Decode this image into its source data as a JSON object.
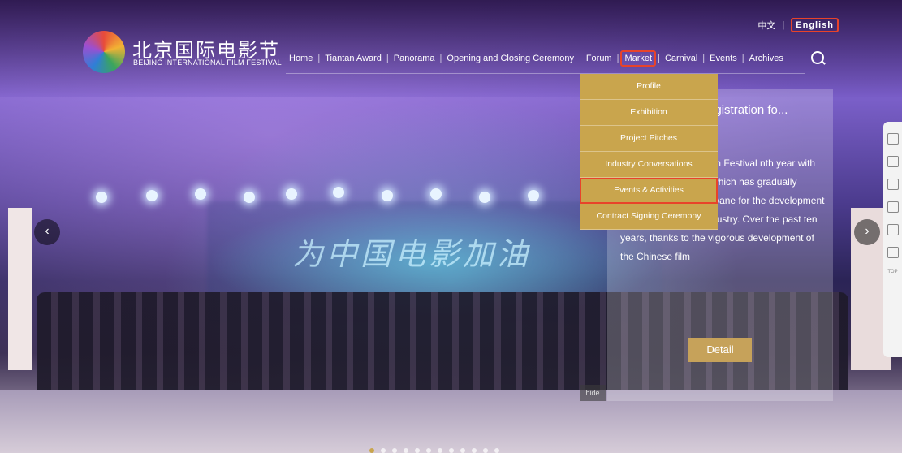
{
  "header": {
    "logo_cn": "北京国际电影节",
    "logo_en": "BEIJING INTERNATIONAL FILM FESTIVAL",
    "lang_cn": "中文",
    "lang_en": "English"
  },
  "nav": {
    "items": [
      "Home",
      "Tiantan Award",
      "Panorama",
      "Opening and Closing Ceremony",
      "Forum",
      "Market",
      "Carnival",
      "Events",
      "Archives"
    ],
    "active": "Market"
  },
  "dropdown": {
    "items": [
      "Profile",
      "Exhibition",
      "Project Pitches",
      "Industry Conversations",
      "Events & Activities",
      "Contract Signing Ceremony"
    ],
    "highlighted": "Events & Activities"
  },
  "panel": {
    "title": "n-Year Pledge for gistration fo...",
    "text": "es after winter, the Film Festival nth year with the of Chinese films, which has gradually become an important vane for the development of the Chinese film industry. Over the past ten years, thanks to the vigorous development of the Chinese film",
    "detail_label": "Detail",
    "hide_label": "hide"
  },
  "stage_text": "为中国电影加油",
  "carousel": {
    "dot_count": 12,
    "active_index": 0
  },
  "colors": {
    "accent": "#c9a54d",
    "highlight": "#e8432a"
  }
}
